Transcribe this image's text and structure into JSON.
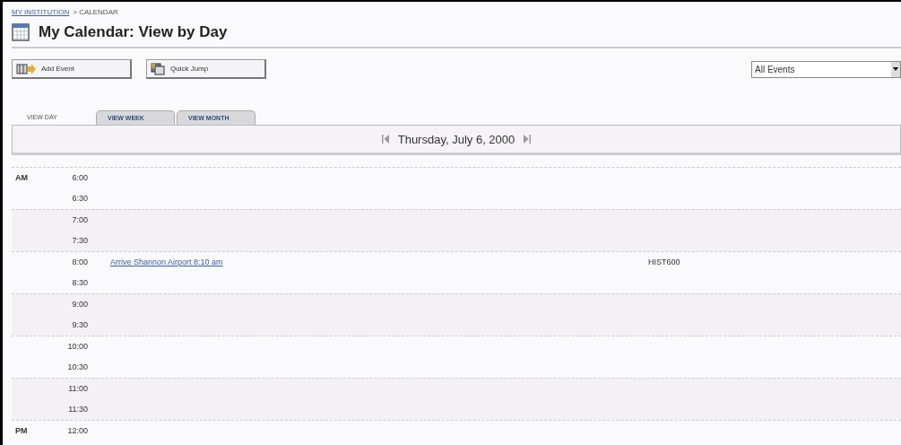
{
  "breadcrumb": [
    {
      "label": "MY INSTITUTION",
      "link": true
    },
    {
      "label": "> CALENDAR",
      "link": false
    }
  ],
  "title": "My Calendar: View by Day",
  "buttons": [
    {
      "label": "Add Event",
      "kind": "add"
    },
    {
      "label": "Quick Jump",
      "kind": "jump"
    }
  ],
  "filter": {
    "value": "All Events"
  },
  "tabs": [
    {
      "label": "VIEW DAY",
      "selected": true
    },
    {
      "label": "VIEW WEEK",
      "selected": false
    },
    {
      "label": "VIEW MONTH",
      "selected": false
    }
  ],
  "date": "Thursday, July 6, 2000",
  "hours": [
    {
      "period": "AM",
      "slots": [
        {
          "time": "6:00"
        },
        {
          "time": "6:30"
        }
      ]
    },
    {
      "slots": [
        {
          "time": "7:00"
        },
        {
          "time": "7:30"
        }
      ]
    },
    {
      "slots": [
        {
          "time": "8:00",
          "event": {
            "title": "Arrive Shannon Airport 8:10 am",
            "course": "HIST600"
          }
        },
        {
          "time": "8:30"
        }
      ]
    },
    {
      "slots": [
        {
          "time": "9:00"
        },
        {
          "time": "9:30"
        }
      ]
    },
    {
      "slots": [
        {
          "time": "10:00"
        },
        {
          "time": "10:30"
        }
      ]
    },
    {
      "slots": [
        {
          "time": "11:00"
        },
        {
          "time": "11:30"
        }
      ]
    },
    {
      "period": "PM",
      "slots": [
        {
          "time": "12:00"
        }
      ]
    }
  ]
}
